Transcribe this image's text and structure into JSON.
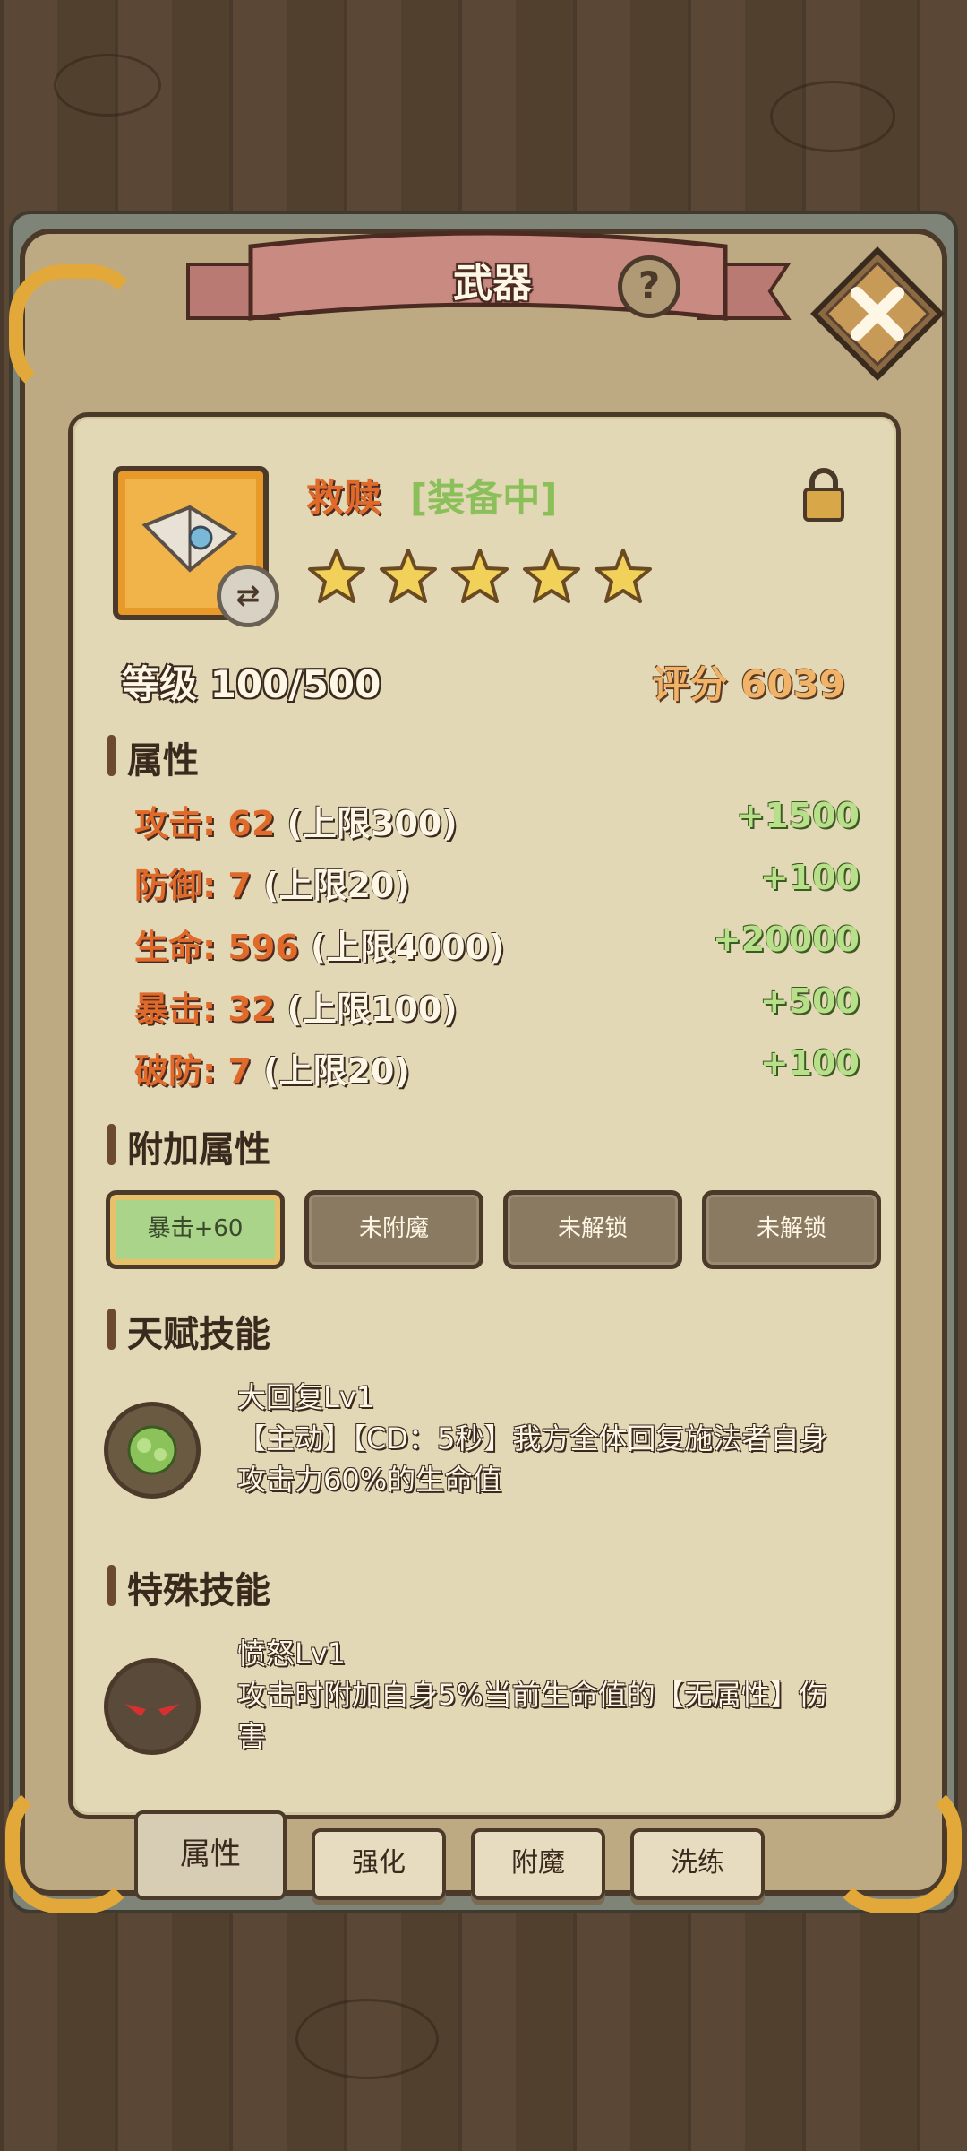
{
  "window": {
    "title": "武器"
  },
  "item": {
    "name": "救赎",
    "status": "[装备中]",
    "stars": 5,
    "level_text": "等级 100/500",
    "score_text": "评分 6039"
  },
  "sections": {
    "attributes": "属性",
    "extra": "附加属性",
    "talent": "天赋技能",
    "special": "特殊技能"
  },
  "attributes": [
    {
      "name": "攻击: 62",
      "cap": " (上限300)",
      "bonus": "+1500"
    },
    {
      "name": "防御: 7",
      "cap": " (上限20)",
      "bonus": "+100"
    },
    {
      "name": "生命: 596",
      "cap": " (上限4000)",
      "bonus": "+20000"
    },
    {
      "name": "暴击: 32",
      "cap": " (上限100)",
      "bonus": "+500"
    },
    {
      "name": "破防: 7",
      "cap": " (上限20)",
      "bonus": "+100"
    }
  ],
  "extra_slots": [
    "暴击+60",
    "未附魔",
    "未解锁",
    "未解锁"
  ],
  "talent_skill": {
    "name": "大回复Lv1",
    "desc": "【主动】【CD：5秒】我方全体回复施法者自身攻击力60%的生命值"
  },
  "special_skill": {
    "name": "愤怒Lv1",
    "desc": "攻击时附加自身5%当前生命值的【无属性】伤害"
  },
  "tabs": [
    "属性",
    "强化",
    "附魔",
    "洗练"
  ],
  "colors": {
    "accent_orange": "#e06a2a",
    "bonus_green": "#b8e08a",
    "gold": "#e2a93a"
  }
}
